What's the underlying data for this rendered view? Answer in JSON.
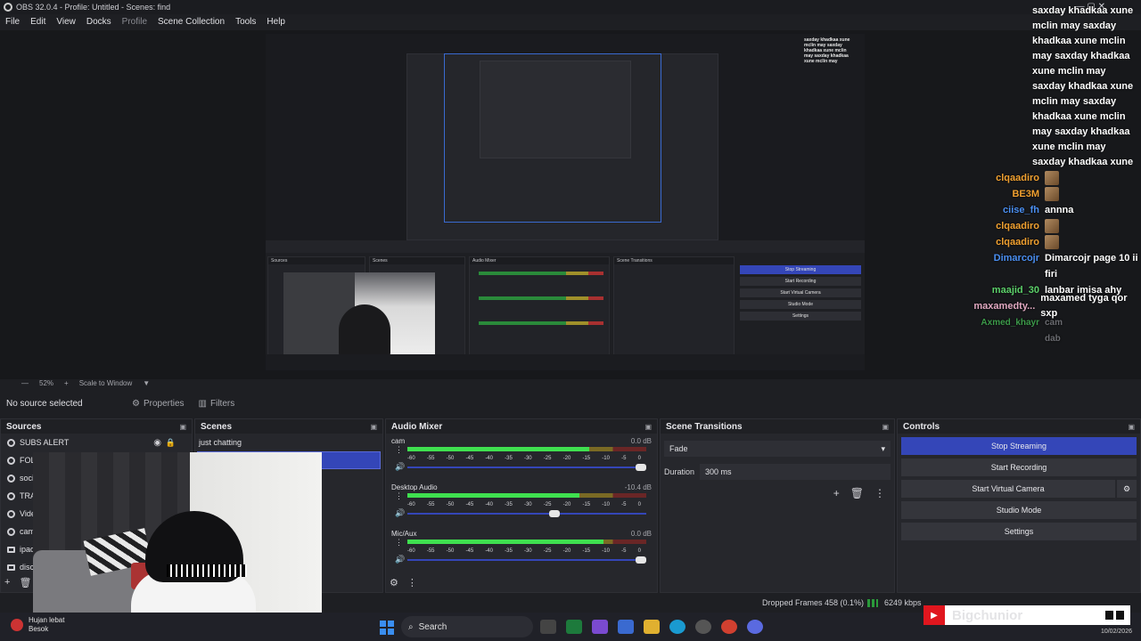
{
  "window": {
    "title": "OBS 32.0.4 - Profile: Untitled - Scenes: find"
  },
  "menu": [
    "File",
    "Edit",
    "View",
    "Docks",
    "Profile",
    "Scene Collection",
    "Tools",
    "Help"
  ],
  "preview": {
    "zoom": "52%",
    "scale_label": "Scale to Window",
    "chat_lines": [
      "saxday khadkaa xune",
      "mclin may saxday",
      "khadkaa xune mclin",
      "may saxday khadkaa",
      "xune mclin may"
    ]
  },
  "chat": {
    "messages": [
      "saxday khadkaa xune",
      "mclin may saxday",
      "khadkaa xune mclin",
      "may saxday khadkaa",
      "xune mclin may",
      "saxday khadkaa xune",
      "mclin may saxday",
      "khadkaa xune mclin",
      "may saxday khadkaa",
      "xune mclin may",
      "saxday khadkaa xune"
    ],
    "users": [
      {
        "name": "clqaadiro",
        "msg": "",
        "color": "#f0a030"
      },
      {
        "name": "BE3M",
        "msg": "",
        "color": "#f0a030"
      },
      {
        "name": "ciise_fh",
        "msg": "annna",
        "color": "#4a8ef0"
      },
      {
        "name": "clqaadiro",
        "msg": "",
        "color": "#f0a030"
      },
      {
        "name": "clqaadiro",
        "msg": "",
        "color": "#f0a030"
      },
      {
        "name": "Dimarcojr",
        "msg": "Dimarcojr page 10 ii",
        "color": "#4a8ef0"
      },
      {
        "name": "",
        "msg": "firi",
        "color": "#ffffff"
      },
      {
        "name": "maajid_30",
        "msg": "lanbar imisa ahy",
        "color": "#5cd06a"
      },
      {
        "name": "maxamedty...",
        "msg": "maxamed tyga qor sxp",
        "color": "#e0a8c0"
      }
    ],
    "faded": [
      "Axmed_khayr",
      "cam",
      "dab"
    ]
  },
  "source_bar": {
    "no_source": "No source selected",
    "properties": "Properties",
    "filters": "Filters"
  },
  "sources": {
    "title": "Sources",
    "items": [
      "SUBS ALERT",
      "FOL",
      "soci",
      "TRA",
      "Vide",
      "cam",
      "ipad",
      "disc"
    ]
  },
  "scenes": {
    "title": "Scenes",
    "items": [
      "just chatting",
      ""
    ]
  },
  "mixer": {
    "title": "Audio Mixer",
    "ticks": [
      "-60",
      "-55",
      "-50",
      "-45",
      "-40",
      "-35",
      "-30",
      "-25",
      "-20",
      "-15",
      "-10",
      "-5",
      "0"
    ],
    "channels": [
      {
        "name": "cam",
        "db": "0.0 dB",
        "level": 0.76,
        "volume": 1.0
      },
      {
        "name": "Desktop Audio",
        "db": "-10.4 dB",
        "level": 0.72,
        "volume": 0.62
      },
      {
        "name": "Mic/Aux",
        "db": "0.0 dB",
        "level": 0.82,
        "volume": 1.0
      }
    ]
  },
  "transitions": {
    "title": "Scene Transitions",
    "selected": "Fade",
    "duration_label": "Duration",
    "duration_value": "300 ms"
  },
  "controls": {
    "title": "Controls",
    "buttons": [
      "Stop Streaming",
      "Start Recording",
      "Start Virtual Camera",
      "Studio Mode",
      "Settings"
    ]
  },
  "status": {
    "dropped": "Dropped Frames 458 (0.1%)",
    "bitrate": "6249 kbps"
  },
  "taskbar": {
    "user_name": "Hujan lebat",
    "user_sub": "Besok",
    "search": "Search",
    "date": "10/02/2026"
  },
  "overlay": {
    "channel": "Bigchunior"
  },
  "colors": {
    "accent": "#3446b8",
    "brand_red": "#e0161e"
  }
}
